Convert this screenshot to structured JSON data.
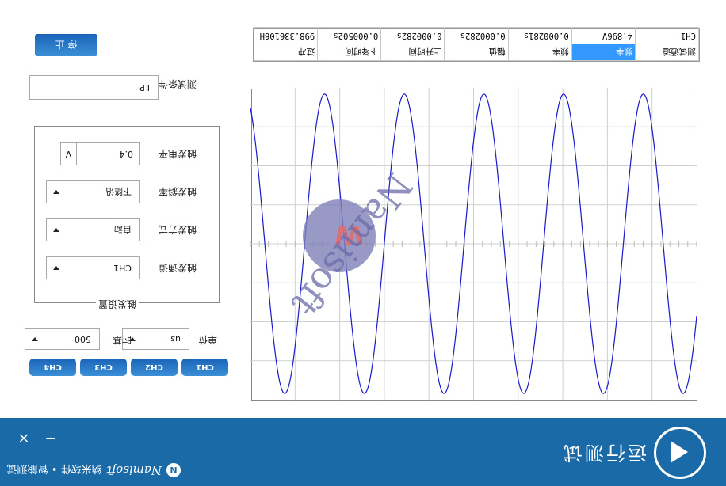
{
  "orientation": "rotated-180",
  "header": {
    "title": "运行测试",
    "brand_mark": "N",
    "brand_name": "Namisoft",
    "brand_tagline": "纳米软件 • 智能测试",
    "minimize": "−",
    "close": "×",
    "bg_color": "#1a6aa8"
  },
  "channels": {
    "buttons": [
      "CH1",
      "CH2",
      "CH3",
      "CH4"
    ],
    "color": "#1a64b8"
  },
  "timebase": {
    "unit_label": "单位",
    "unit_value": "us",
    "time_label": "时基",
    "time_value": "500"
  },
  "trigger": {
    "group_title": "触发设置",
    "channel_label": "触发通道",
    "channel_value": "CH1",
    "mode_label": "触发方式",
    "mode_value": "自动",
    "slope_label": "触发斜率",
    "slope_value": "下降沿",
    "level_label": "触发电平",
    "level_value": "0.4",
    "level_unit": "V"
  },
  "test_condition": {
    "label": "测试条件",
    "value": "LP"
  },
  "stop_button": "停 止",
  "table": {
    "headers": [
      "测试通道",
      "频率",
      "频率",
      "幅值",
      "上升时间",
      "下降时间",
      "过冲"
    ],
    "selected_header_index": 1,
    "rows": [
      [
        "CH1",
        "4.896V",
        "0.000281s",
        "0.000282s",
        "0.000282s",
        "0.000502s",
        "998.336106H"
      ]
    ]
  },
  "watermark": {
    "text": "Namisoft",
    "mark": "W"
  },
  "chart_data": {
    "type": "line",
    "title": "",
    "xlabel": "",
    "ylabel": "",
    "grid": true,
    "line_color": "#1a1acc",
    "series": [
      {
        "name": "",
        "waveform": "sine",
        "cycles_visible": 5.6,
        "peak_fraction": 0.96,
        "zero_phase_fraction": 0.08
      }
    ]
  }
}
